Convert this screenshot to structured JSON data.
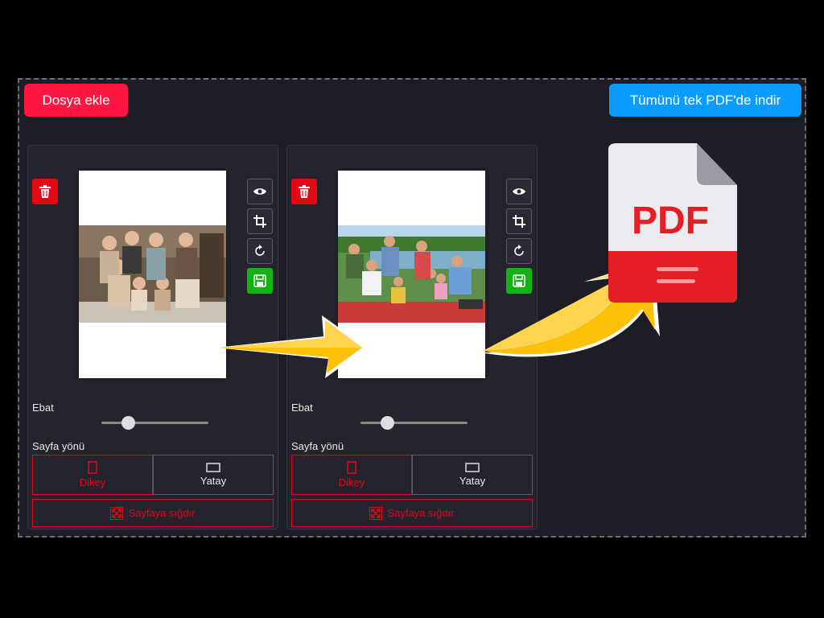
{
  "toolbar": {
    "add_file_label": "Dosya ekle",
    "download_all_label": "Tümünü tek PDF'de indir"
  },
  "cards": [
    {
      "size_label": "Ebat",
      "size_value_fraction": 0.25,
      "orientation_label": "Sayfa yönü",
      "portrait_label": "Dikey",
      "landscape_label": "Yatay",
      "selected_orientation": "Dikey",
      "fit_label": "Sayfaya sığdır"
    },
    {
      "size_label": "Ebat",
      "size_value_fraction": 0.25,
      "orientation_label": "Sayfa yönü",
      "portrait_label": "Dikey",
      "landscape_label": "Yatay",
      "selected_orientation": "Dikey",
      "fit_label": "Sayfaya sığdır"
    }
  ],
  "pdf_icon": {
    "label": "PDF"
  },
  "icons": {
    "delete": "trash-icon",
    "preview": "eye-icon",
    "crop": "crop-icon",
    "rotate": "rotate-icon",
    "save": "save-icon",
    "fit": "expand-icon"
  },
  "colors": {
    "accent_red": "#e30613",
    "add_button": "#ff1744",
    "download_button": "#0a9dff",
    "save_green": "#12b312",
    "arrow_yellow": "#ffc107"
  }
}
